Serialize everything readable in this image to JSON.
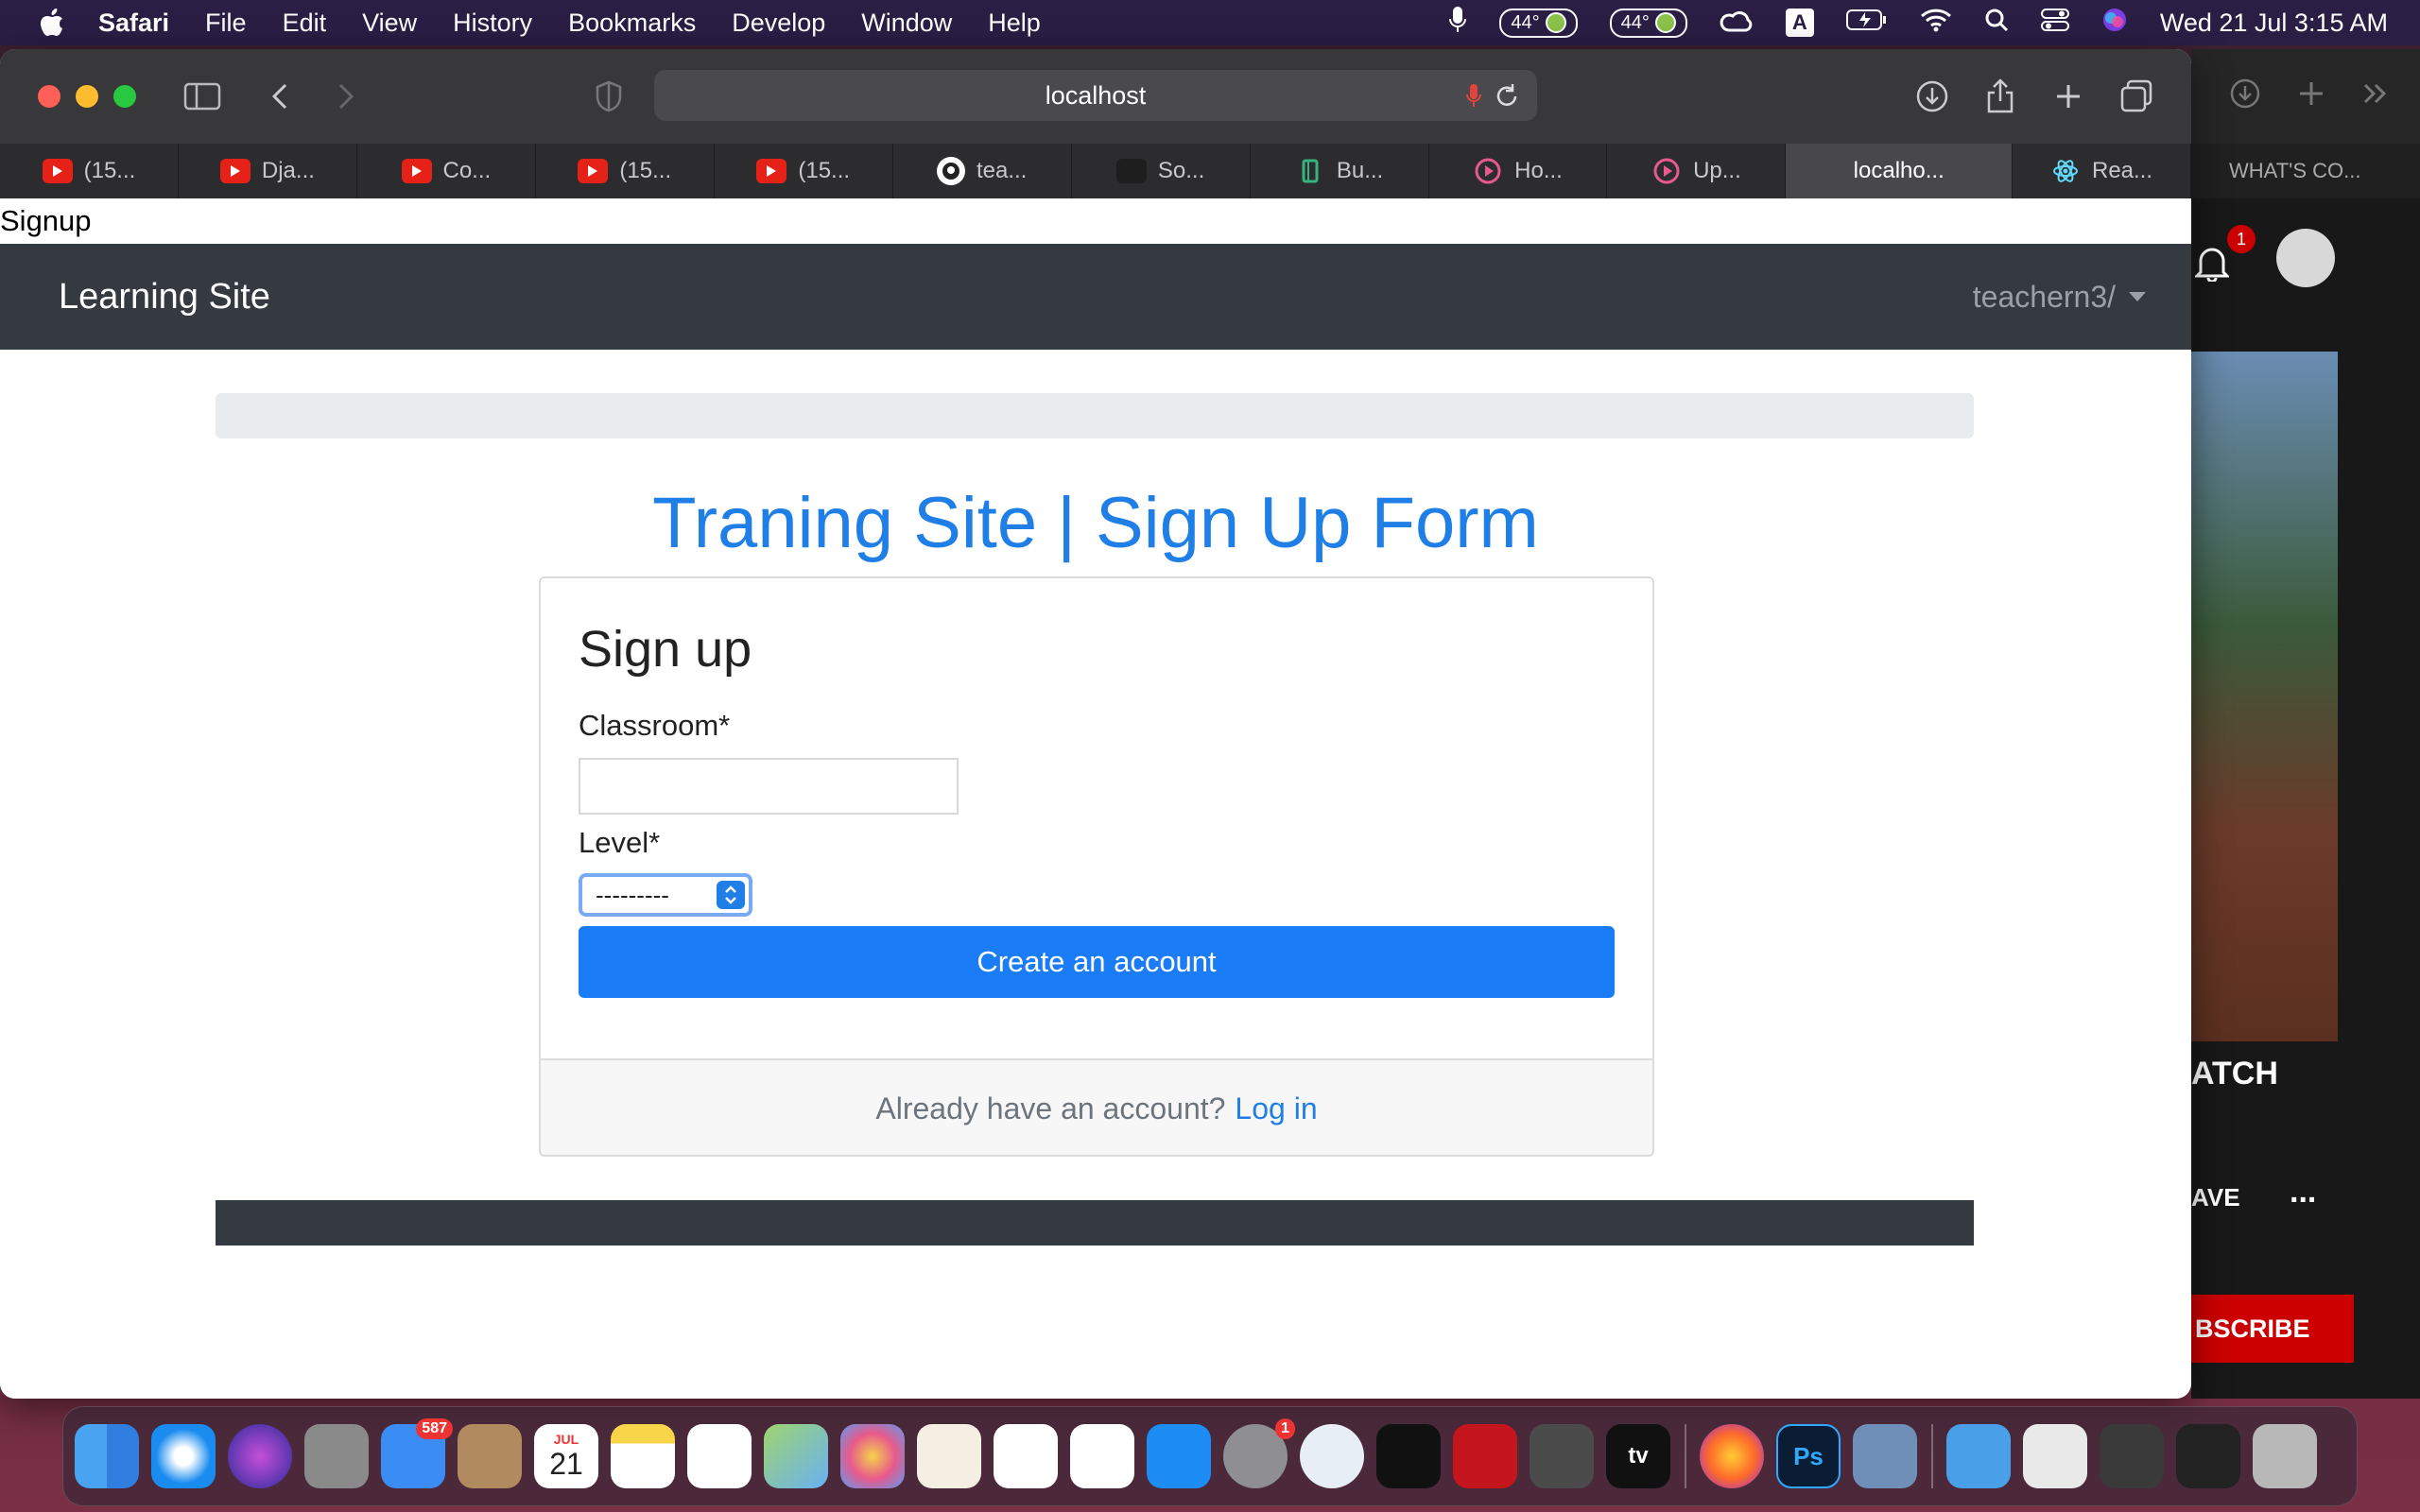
{
  "menubar": {
    "app": "Safari",
    "items": [
      "File",
      "Edit",
      "View",
      "History",
      "Bookmarks",
      "Develop",
      "Window",
      "Help"
    ],
    "temp1": "44°",
    "temp2": "44°",
    "letter": "A",
    "datetime": "Wed 21 Jul  3:15 AM"
  },
  "browser": {
    "url": "localhost",
    "tabs": [
      {
        "label": "(15...",
        "icon": "youtube-icon"
      },
      {
        "label": "Dja...",
        "icon": "youtube-icon"
      },
      {
        "label": "Co...",
        "icon": "youtube-icon"
      },
      {
        "label": "(15...",
        "icon": "youtube-icon"
      },
      {
        "label": "(15...",
        "icon": "youtube-icon"
      },
      {
        "label": "tea...",
        "icon": "github-icon"
      },
      {
        "label": "So...",
        "icon": "generic-icon"
      },
      {
        "label": "Bu...",
        "icon": "book-icon"
      },
      {
        "label": "Ho...",
        "icon": "play-icon"
      },
      {
        "label": "Up...",
        "icon": "play-icon"
      },
      {
        "label": "localho...",
        "icon": "none",
        "active": true
      },
      {
        "label": "Rea...",
        "icon": "react-icon"
      }
    ]
  },
  "page": {
    "doc_title": "Signup",
    "navbar": {
      "brand": "Learning Site",
      "user": "teachern3/"
    },
    "heading": "Traning Site | Sign Up Form",
    "card": {
      "title": "Sign up",
      "classroom_label": "Classroom*",
      "classroom_value": "",
      "level_label": "Level*",
      "level_selected": "---------",
      "submit_label": "Create an account",
      "footer_text": "Already have an account?",
      "login_link": "Log in"
    }
  },
  "side_window": {
    "tab_label": "WHAT'S CO...",
    "notification_count": "1",
    "watch_text": "ATCH",
    "save_text": "AVE",
    "more": "...",
    "subscribe": "BSCRIBE"
  },
  "dock": {
    "mail_badge": "587",
    "calendar_month": "JUL",
    "calendar_day": "21",
    "settings_badge": "1",
    "ps_label": "Ps",
    "tv_label": "tv"
  },
  "colors": {
    "accent": "#1a7cf6",
    "navbar": "#343a40",
    "heading": "#1f7fe6"
  }
}
